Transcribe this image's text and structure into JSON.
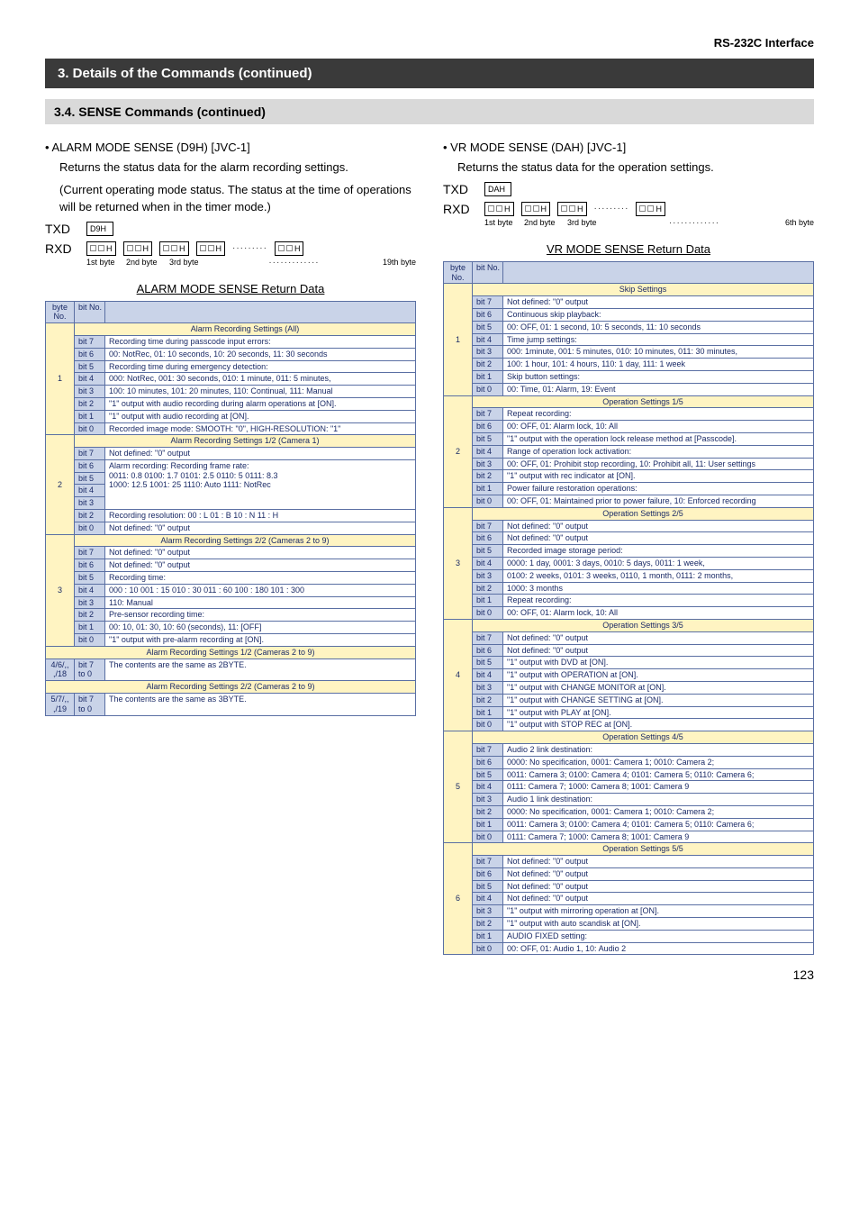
{
  "header": {
    "right": "RS-232C Interface"
  },
  "black_bar": "3. Details of the Commands (continued)",
  "gray_bar": "3.4. SENSE Commands (continued)",
  "left": {
    "title": "•   ALARM MODE SENSE (D9H) [JVC-1]",
    "p1": "Returns the status data for the alarm recording settings.",
    "p2": "(Current operating mode status. The status at the time of operations will be returned when in the timer mode.)",
    "txd_label": "TXD",
    "rxd_label": "RXD",
    "txd_code": "D9H",
    "byte1": "1st byte",
    "byte2": "2nd byte",
    "byte3": "3rd byte",
    "byte_last": "19th byte",
    "ret_title": "ALARM MODE SENSE Return Data",
    "head_byte": "byte No.",
    "head_bit": "bit No.",
    "section_all": "Alarm Recording Settings (All)",
    "r1": {
      "b7": "bit 7",
      "t7": "Recording time during passcode input errors:",
      "b6": "bit 6",
      "t6": "00: NotRec, 01: 10 seconds, 10: 20 seconds, 11: 30 seconds",
      "b5": "bit 5",
      "t5": "Recording time during emergency detection:",
      "b4": "bit 4",
      "t4": "000: NotRec, 001: 30 seconds, 010: 1 minute, 011: 5 minutes,",
      "b3": "bit 3",
      "t3": "100: 10 minutes, 101: 20 minutes, 110: Continual, 111: Manual",
      "b2": "bit 2",
      "t2": "\"1\" output with audio recording during alarm operations at [ON].",
      "b1": "bit 1",
      "t1": "\"1\" output with audio recording at [ON].",
      "b0": "bit 0",
      "t0": "Recorded image mode: SMOOTH: \"0\", HIGH-RESOLUTION: \"1\""
    },
    "section_12_c1": "Alarm Recording Settings 1/2 (Camera 1)",
    "r2": {
      "b7": "bit 7",
      "t7": "Not defined: \"0\" output",
      "b6": "bit 6",
      "b5": "bit 5",
      "b4": "bit 4",
      "b3": "bit 3",
      "a65": "Alarm recording: Recording frame rate:",
      "a65b": "0011: 0.8   0100: 1.7   0101: 2.5   0110: 5   0111: 8.3",
      "a65c": "1000: 12.5   1001: 25   1110: Auto   1111: NotRec",
      "b2": "bit 2",
      "b1": "bit 1",
      "a21": "Recording resolution: 00 : L  01 : B  10 : N  11 : H",
      "b0": "bit 0",
      "t0": "Not defined: \"0\" output"
    },
    "section_22_c29": "Alarm Recording Settings 2/2 (Cameras 2 to 9)",
    "r3": {
      "b7": "bit 7",
      "t7": "Not defined: \"0\" output",
      "b6": "bit 6",
      "t6": "Not defined: \"0\" output",
      "b5": "bit 5",
      "t5": "Recording time:",
      "b4": "bit 4",
      "t4": "000 : 10   001 : 15   010 : 30   011 : 60   100 : 180   101 : 300",
      "b3": "bit 3",
      "t3": "110: Manual",
      "b2": "bit 2",
      "t2": "Pre-sensor recording time:",
      "b1": "bit 1",
      "t1": "00: 10, 01: 30, 10: 60 (seconds), 11: [OFF]",
      "b0": "bit 0",
      "t0": "\"1\" output with pre-alarm recording at [ON]."
    },
    "section_12_c29a": "Alarm Recording Settings 1/2 (Cameras 2 to 9)",
    "r4": {
      "byte": "4/6/,,\n,/18",
      "bits": "bit 7\nto 0",
      "text": "The contents are the same as 2BYTE."
    },
    "section_22_c29b": "Alarm Recording Settings 2/2 (Cameras 2 to 9)",
    "r5": {
      "byte": "5/7/,,\n,/19",
      "bits": "bit 7\nto 0",
      "text": "The contents are the same as 3BYTE."
    }
  },
  "right": {
    "title": "•   VR MODE SENSE (DAH) [JVC-1]",
    "p1": "Returns the status data for the operation settings.",
    "txd_label": "TXD",
    "rxd_label": "RXD",
    "txd_code": "DAH",
    "byte1": "1st byte",
    "byte2": "2nd byte",
    "byte3": "3rd byte",
    "byte_last": "6th byte",
    "ret_title": "VR MODE SENSE Return Data",
    "head_byte": "byte No.",
    "head_bit": "bit No.",
    "s_skip": "Skip Settings",
    "r1": {
      "b7": "bit 7",
      "t7": "Not defined: \"0\" output",
      "b6": "bit 6",
      "t6": "Continuous skip playback:",
      "b5": "bit 5",
      "t5": "00: OFF, 01: 1 second, 10: 5 seconds, 11: 10 seconds",
      "b4": "bit 4",
      "t4": "Time jump settings:",
      "b3": "bit 3",
      "t3": "000: 1minute, 001: 5 minutes, 010: 10 minutes, 011: 30 minutes,",
      "b2": "bit 2",
      "t2": "100: 1 hour, 101: 4 hours, 110: 1 day, 111: 1 week",
      "b1": "bit 1",
      "t1": "Skip button settings:",
      "b0": "bit 0",
      "t0": "00: Time, 01: Alarm, 19: Event"
    },
    "s_op15": "Operation Settings 1/5",
    "r2": {
      "b7": "bit 7",
      "t7": "Repeat recording:",
      "b6": "bit 6",
      "t6": "00: OFF, 01: Alarm lock, 10: All",
      "b5": "bit 5",
      "t5": "\"1\" output with the operation lock release method at [Passcode].",
      "b4": "bit 4",
      "t4": "Range of operation lock activation:",
      "b3": "bit 3",
      "t3": "00: OFF, 01: Prohibit stop recording, 10: Prohibit all, 11: User settings",
      "b2": "bit 2",
      "t2": "\"1\" output with rec indicator at [ON].",
      "b1": "bit 1",
      "t1": "Power failure restoration operations:",
      "b0": "bit 0",
      "t0": "00: OFF, 01: Maintained prior to power failure, 10: Enforced recording"
    },
    "s_op25": "Operation Settings 2/5",
    "r3": {
      "b7": "bit 7",
      "t7": "Not defined: \"0\" output",
      "b6": "bit 6",
      "t6": "Not defined: \"0\" output",
      "b5": "bit 5",
      "t5": "Recorded image storage period:",
      "b4": "bit 4",
      "t4": "0000: 1 day, 0001: 3 days, 0010: 5 days, 0011: 1 week,",
      "b3": "bit 3",
      "t3": "0100: 2 weeks, 0101: 3 weeks, 0110, 1 month, 0111: 2 months,",
      "b2": "bit 2",
      "t2": "1000: 3 months",
      "b1": "bit 1",
      "t1": "Repeat recording:",
      "b0": "bit 0",
      "t0": "00: OFF, 01: Alarm lock, 10: All"
    },
    "s_op35": "Operation Settings 3/5",
    "r4": {
      "b7": "bit 7",
      "t7": "Not defined: \"0\" output",
      "b6": "bit 6",
      "t6": "Not defined: \"0\" output",
      "b5": "bit 5",
      "t5": "\"1\" output with DVD at [ON].",
      "b4": "bit 4",
      "t4": "\"1\" output with OPERATION at [ON].",
      "b3": "bit 3",
      "t3": "\"1\" output with CHANGE MONITOR at [ON].",
      "b2": "bit 2",
      "t2": "\"1\" output with CHANGE SETTING at [ON].",
      "b1": "bit 1",
      "t1": "\"1\" output with PLAY at [ON].",
      "b0": "bit 0",
      "t0": "\"1\" output with STOP REC at [ON]."
    },
    "s_op45": "Operation Settings 4/5",
    "r5": {
      "b7": "bit 7",
      "t7": "Audio 2 link destination:",
      "b6": "bit 6",
      "t6": "0000: No specification, 0001: Camera 1; 0010: Camera 2;",
      "b5": "bit 5",
      "t5": "0011: Camera 3; 0100: Camera 4; 0101: Camera 5; 0110: Camera 6;",
      "b4": "bit 4",
      "t4": "0111: Camera 7; 1000: Camera 8; 1001: Camera 9",
      "b3": "bit 3",
      "t3": "Audio 1 link destination:",
      "b2": "bit 2",
      "t2": "0000: No specification, 0001: Camera 1; 0010: Camera 2;",
      "b1": "bit 1",
      "t1": "0011: Camera 3; 0100: Camera 4; 0101: Camera 5; 0110: Camera 6;",
      "b0": "bit 0",
      "t0": "0111: Camera 7; 1000: Camera 8; 1001: Camera 9"
    },
    "s_op55": "Operation Settings 5/5",
    "r6": {
      "b7": "bit 7",
      "t7": "Not defined: \"0\" output",
      "b6": "bit 6",
      "t6": "Not defined: \"0\" output",
      "b5": "bit 5",
      "t5": "Not defined: \"0\" output",
      "b4": "bit 4",
      "t4": "Not defined: \"0\" output",
      "b3": "bit 3",
      "t3": "\"1\" output with mirroring operation at [ON].",
      "b2": "bit 2",
      "t2": "\"1\" output with auto scandisk at [ON].",
      "b1": "bit 1",
      "t1": "AUDIO FIXED setting:",
      "b0": "bit 0",
      "t0": "00: OFF, 01: Audio 1, 10: Audio 2"
    }
  },
  "page": "123"
}
